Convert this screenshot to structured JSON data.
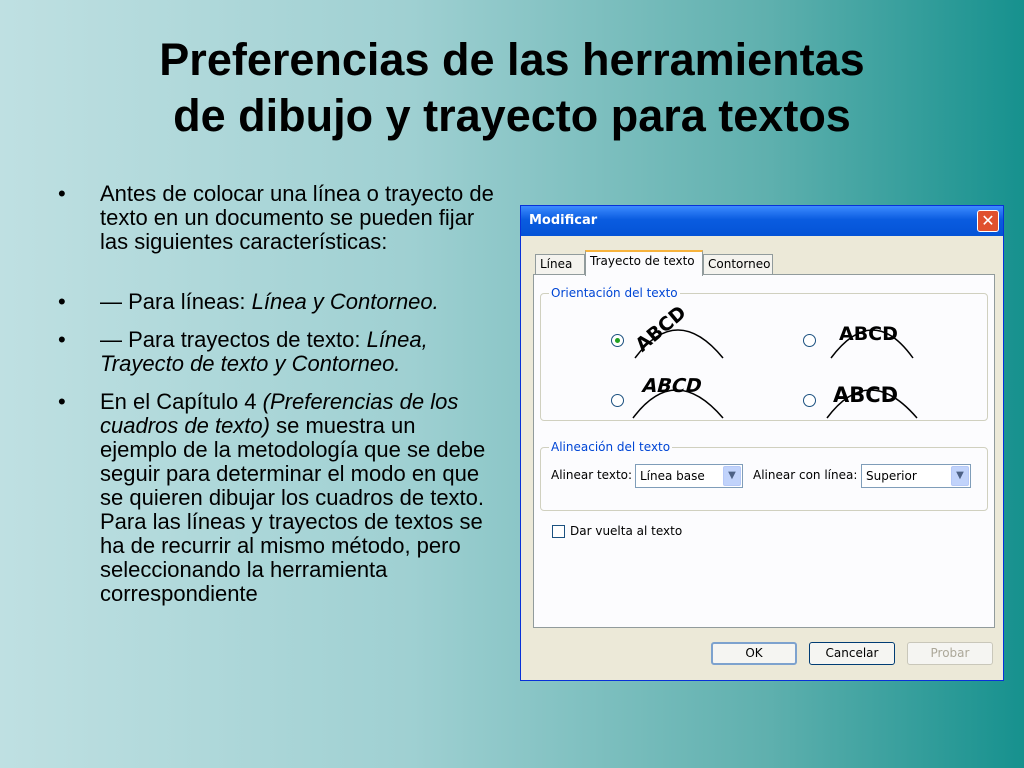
{
  "slide": {
    "title_line1": "Preferencias de las herramientas",
    "title_line2": "de dibujo y trayecto para textos"
  },
  "bullets": [
    {
      "dot": "•",
      "text": "Antes de colocar una línea o trayecto de texto en un documento se pueden fijar las siguientes características:"
    },
    {
      "dot": "•",
      "pre": "— Para líneas: ",
      "italic": "Línea y Contorneo."
    },
    {
      "dot": "•",
      "pre": "— Para trayectos de texto: ",
      "italic": "Línea, Trayecto de texto y Contorneo."
    },
    {
      "dot": "•",
      "pre": "En el Capítulo 4 ",
      "italic": "(Preferencias de los cuadros de texto)",
      "post": " se muestra un ejemplo de la metodología que se debe seguir para determinar el modo en que se quieren dibujar los cuadros de texto. Para las líneas y trayectos de textos se ha de recurrir al mismo método, pero seleccionando la herramienta correspondiente"
    }
  ],
  "dialog": {
    "title": "Modificar",
    "close_glyph": "✕",
    "tabs": [
      "Línea",
      "Trayecto de texto",
      "Contorneo"
    ],
    "active_tab": "Trayecto de texto",
    "orientation_group": "Orientación del texto",
    "orientation_samples": [
      "ABCD",
      "ABCD",
      "ABCD",
      "ABCD"
    ],
    "orientation_selected": 1,
    "alignment_group": "Alineación del texto",
    "align_text_label": "Alinear texto:",
    "align_text_value": "Línea base",
    "align_line_label": "Alinear con línea:",
    "align_line_value": "Superior",
    "wrap_label": "Dar vuelta al texto",
    "wrap_checked": false,
    "ok_label": "OK",
    "cancel_label": "Cancelar",
    "preview_label": "Probar"
  },
  "colors": {
    "titlebar": "#0a5ce0",
    "legend_text": "#0046d5",
    "dialog_bg": "#ece9d8"
  }
}
